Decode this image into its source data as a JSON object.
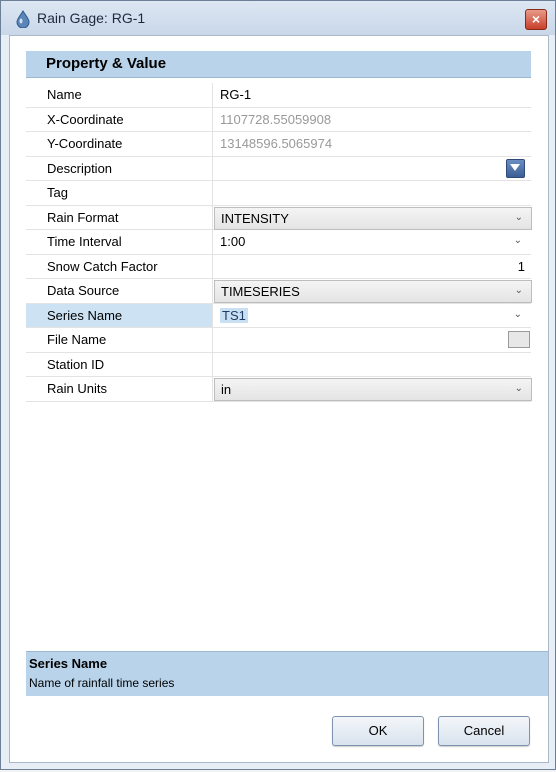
{
  "window": {
    "title": "Rain Gage: RG-1",
    "close_label": "×"
  },
  "grid": {
    "header": "Property  &  Value",
    "rows": [
      {
        "label": "Name",
        "value": "RG-1"
      },
      {
        "label": "X-Coordinate",
        "value": "1107728.55059908"
      },
      {
        "label": "Y-Coordinate",
        "value": "13148596.5065974"
      },
      {
        "label": "Description",
        "value": ""
      },
      {
        "label": "Tag",
        "value": ""
      },
      {
        "label": "Rain Format",
        "value": "INTENSITY"
      },
      {
        "label": "Time Interval",
        "value": "1:00"
      },
      {
        "label": "Snow Catch Factor",
        "value": "1"
      },
      {
        "label": "Data Source",
        "value": "TIMESERIES"
      },
      {
        "label": "Series Name",
        "value": "TS1"
      },
      {
        "label": "File Name",
        "value": ""
      },
      {
        "label": "Station ID",
        "value": ""
      },
      {
        "label": "Rain Units",
        "value": "in"
      }
    ]
  },
  "help": {
    "title": "Series Name",
    "description": "Name of rainfall time series"
  },
  "buttons": {
    "ok": "OK",
    "cancel": "Cancel"
  },
  "colors": {
    "header_bg": "#b8d3ea",
    "selected_row": "#cde3f4"
  }
}
